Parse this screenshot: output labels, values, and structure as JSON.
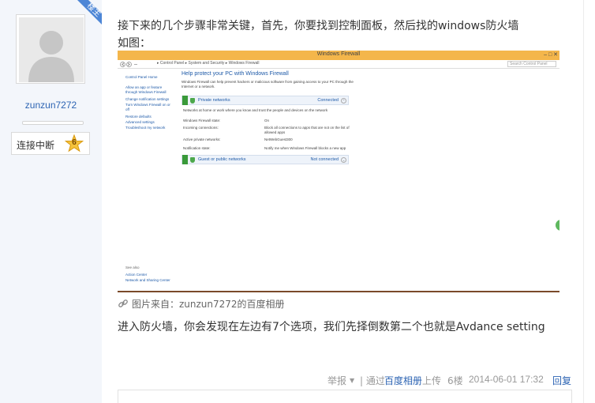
{
  "author": {
    "badge_label": "楼主",
    "username": "zunzun7272",
    "level_name": "连接中断",
    "level_number": "6"
  },
  "post": {
    "line1": "接下来的几个步骤非常关键，首先，你要找到控制面板，然后找的windows防火墙",
    "line2": "如图：",
    "line3": "进入防火墙，你会发现在左边有7个选项，我们先择倒数第二个也就是Avdance setting",
    "image_caption": "图片来自：zunzun7272的百度相册"
  },
  "embedded_screenshot": {
    "window_title": "Windows Firewall",
    "window_controls": "–  □  ✕",
    "address_path": "▸ Control Panel ▸ System and Security ▸ Windows Firewall",
    "search_placeholder": "Search Control Panel",
    "sidebar": [
      "Control Panel Home",
      "Allow an app or feature",
      "through Windows Firewall",
      "Change notification settings",
      "Turn Windows Firewall on or",
      "off",
      "Restore defaults",
      "Advanced settings",
      "Troubleshoot my network"
    ],
    "see_also": [
      "See also",
      "Action Center",
      "Network and Sharing Center"
    ],
    "heading": "Help protect your PC with Windows Firewall",
    "description": "Windows Firewall can help prevent hackers or malicious software from gaining access to your PC through the Internet or a network.",
    "private_network": {
      "label": "Private networks",
      "status": "Connected",
      "note": "Networks at home or work where you know and trust the people and devices on the network",
      "rows": [
        {
          "label": "Windows Firewall state:",
          "value": "On"
        },
        {
          "label": "Incoming connections:",
          "value": "Block all connections to apps that are not on the list of allowed apps"
        },
        {
          "label": "Active private networks:",
          "value": "NetWebGuest300"
        },
        {
          "label": "Notification state:",
          "value": "Notify me when Windows Firewall blocks a new app"
        }
      ]
    },
    "public_network": {
      "label": "Guest or public networks",
      "status": "Not connected"
    }
  },
  "footer": {
    "report": "举报",
    "via_prefix": "| 通过",
    "via_link": "百度相册",
    "via_suffix": "上传",
    "floor": "6楼",
    "timestamp": "2014-06-01 17:32",
    "reply": "回复"
  },
  "colors": {
    "link": "#2d64b3",
    "badge": "#4d86d6",
    "left_panel": "#f3f6fb"
  }
}
